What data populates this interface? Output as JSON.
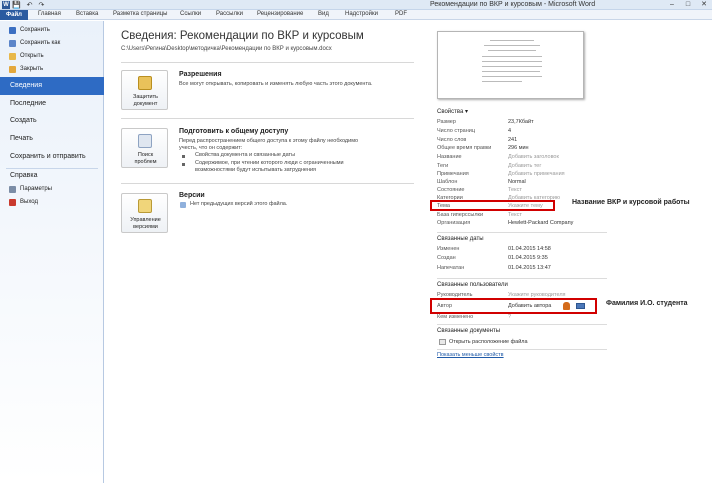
{
  "window": {
    "title": "Рекомендации по ВКР и курсовым  -  Microsoft Word",
    "app_icon": "W",
    "qat_icons": [
      "save-icon",
      "undo-icon",
      "redo-icon"
    ],
    "controls": [
      "minimize-icon",
      "maximize-icon",
      "close-icon"
    ]
  },
  "ribbon_tabs": [
    "Файл",
    "Главная",
    "Вставка",
    "Разметка страницы",
    "Ссылки",
    "Рассылки",
    "Рецензирование",
    "Вид",
    "Надстройки",
    "PDF"
  ],
  "nav": {
    "commands": [
      {
        "label": "Сохранить",
        "icon": "save-icon"
      },
      {
        "label": "Сохранить как",
        "icon": "save-as-icon"
      },
      {
        "label": "Открыть",
        "icon": "open-folder-icon"
      },
      {
        "label": "Закрыть",
        "icon": "close-document-icon"
      }
    ],
    "items": [
      "Сведения",
      "Последние",
      "Создать",
      "Печать",
      "Сохранить и отправить",
      "Справка"
    ],
    "bottom": [
      {
        "label": "Параметры",
        "icon": "options-icon"
      },
      {
        "label": "Выход",
        "icon": "exit-icon"
      }
    ]
  },
  "main": {
    "heading": "Сведения: Рекомендации по ВКР и курсовым",
    "path": "C:\\Users\\Регина\\Desktop\\методичка\\Рекомендации по ВКР и курсовым.docx",
    "permissions": {
      "button_line1": "Защитить",
      "button_line2": "документ",
      "title": "Разрешения",
      "text": "Все могут открывать, копировать и изменять любую часть этого документа."
    },
    "prepare": {
      "button_line1": "Поиск",
      "button_line2": "проблем",
      "title": "Подготовить к общему доступу",
      "text1": "Перед распространением общего доступа к этому файлу необходимо",
      "text2": "учесть, что он содержит:",
      "bullet1": "Свойства документа и связанные даты",
      "bullet2a": "Содержимое, при чтении которого люди с ограниченными",
      "bullet2b": "возможностями будут испытывать затруднения"
    },
    "versions": {
      "button_line1": "Управление",
      "button_line2": "версиями",
      "title": "Версии",
      "text": "Нет предыдущих версий этого файла."
    }
  },
  "properties": {
    "header": "Свойства",
    "rows": [
      {
        "k": "Размер",
        "v": "23,7Кбайт"
      },
      {
        "k": "Число страниц",
        "v": "4"
      },
      {
        "k": "Число слов",
        "v": "241"
      },
      {
        "k": "Общее время правки",
        "v": "296 мин"
      },
      {
        "k": "Название",
        "v": "Добавить заголовок"
      },
      {
        "k": "Теги",
        "v": "Добавить тег"
      },
      {
        "k": "Примечания",
        "v": "Добавить примечания"
      },
      {
        "k": "Шаблон",
        "v": "Normal"
      },
      {
        "k": "Состояние",
        "v": "Текст"
      },
      {
        "k": "Категории",
        "v": "Добавить категорию"
      },
      {
        "k": "Тема",
        "v": "Укажите тему"
      },
      {
        "k": "База гиперссылки",
        "v": "Текст"
      },
      {
        "k": "Организация",
        "v": "Hewlett-Packard Company"
      }
    ],
    "dates_header": "Связанные даты",
    "dates": [
      {
        "k": "Изменен",
        "v": "01.04.2015 14:58"
      },
      {
        "k": "Создан",
        "v": "01.04.2015 9:35"
      },
      {
        "k": "Напечатан",
        "v": "01.04.2015 13:47"
      }
    ],
    "people_header": "Связанные пользователи",
    "people": [
      {
        "k": "Руководитель",
        "v": "Укажите руководителя"
      },
      {
        "k": "Автор",
        "v": "Добавить автора"
      },
      {
        "k": "Кем изменено",
        "v": "?"
      }
    ],
    "docs_header": "Связанные документы",
    "open_location": "Открыть расположение файла",
    "show_fewer": "Показать меньше свойств"
  },
  "annotations": {
    "topic": "Название ВКР и курсовой работы",
    "author": "Фамилия И.О. студента"
  },
  "colors": {
    "accent": "#2e6bc4",
    "file_tab": "#2a5aa0",
    "highlight_box": "#d10000"
  }
}
